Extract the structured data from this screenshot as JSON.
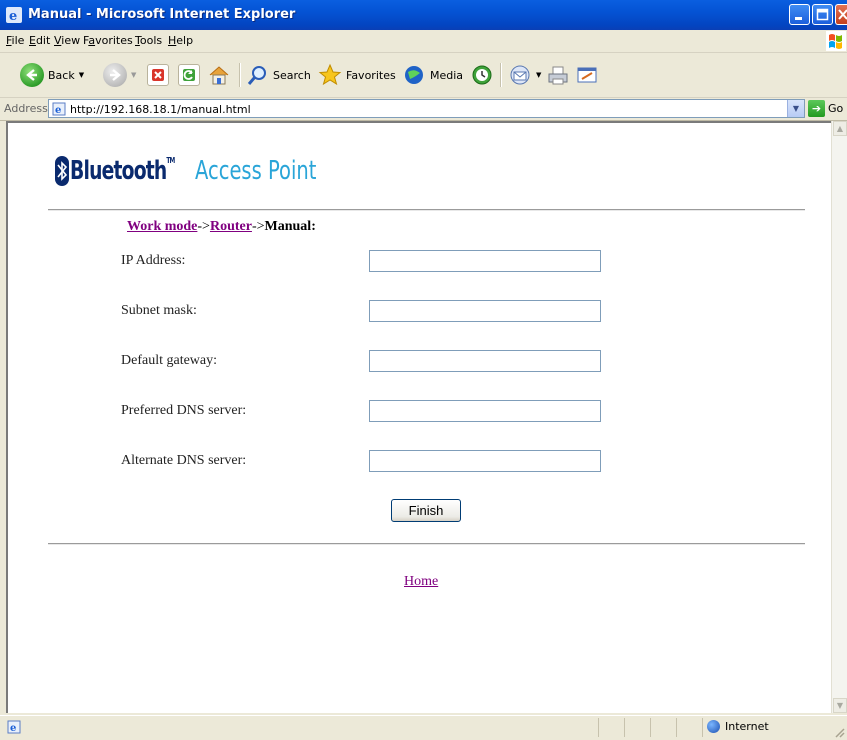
{
  "window": {
    "title": "Manual - Microsoft Internet Explorer"
  },
  "menu": [
    {
      "label": "File",
      "accel_index": 0
    },
    {
      "label": "Edit",
      "accel_index": 0
    },
    {
      "label": "View",
      "accel_index": 0
    },
    {
      "label": "Favorites",
      "accel_index": 1
    },
    {
      "label": "Tools",
      "accel_index": 0
    },
    {
      "label": "Help",
      "accel_index": 0
    }
  ],
  "toolbar": {
    "back_label": "Back",
    "search_label": "Search",
    "favorites_label": "Favorites",
    "media_label": "Media"
  },
  "address": {
    "label": "Address",
    "url": "http://192.168.18.1/manual.html",
    "go_label": "Go"
  },
  "page": {
    "logo_brand": "Bluetooth",
    "logo_tm": "TM",
    "logo_product": "Access Point",
    "breadcrumb": {
      "link1": "Work mode",
      "sep1": "->",
      "link2": "Router",
      "sep2": "->",
      "current": "Manual:"
    },
    "fields": [
      {
        "label": "IP Address:",
        "value": ""
      },
      {
        "label": "Subnet mask:",
        "value": ""
      },
      {
        "label": "Default gateway:",
        "value": ""
      },
      {
        "label": "Preferred DNS server:",
        "value": ""
      },
      {
        "label": "Alternate DNS server:",
        "value": ""
      }
    ],
    "finish_label": "Finish",
    "home_label": "Home"
  },
  "status": {
    "zone": "Internet"
  }
}
